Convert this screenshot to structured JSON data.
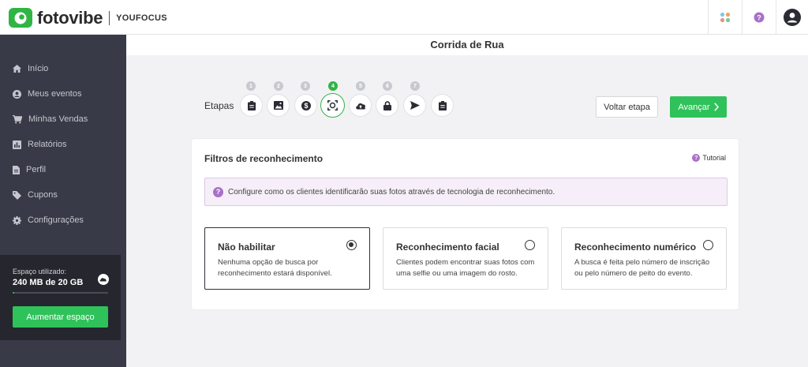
{
  "header": {
    "brand": "fotovibe",
    "sub_brand": "YOUFOCUS",
    "icons": [
      "apps-grid-icon",
      "help-icon",
      "user-avatar-icon"
    ]
  },
  "sidebar": {
    "items": [
      {
        "label": "Início",
        "icon": "home-icon"
      },
      {
        "label": "Meus eventos",
        "icon": "user-circle-icon"
      },
      {
        "label": "Minhas Vendas",
        "icon": "cart-icon"
      },
      {
        "label": "Relatórios",
        "icon": "chart-icon"
      },
      {
        "label": "Perfil",
        "icon": "profile-doc-icon"
      },
      {
        "label": "Cupons",
        "icon": "tag-icon"
      },
      {
        "label": "Configurações",
        "icon": "gear-icon"
      }
    ],
    "storage": {
      "label": "Espaço utilizado:",
      "value": "240 MB de 20 GB",
      "used_fraction": 0.012,
      "button": "Aumentar espaço"
    }
  },
  "page": {
    "title": "Corrida de Rua",
    "steps_label": "Etapas",
    "steps": [
      {
        "num": "1",
        "icon": "clipboard-icon",
        "active": false
      },
      {
        "num": "2",
        "icon": "image-icon",
        "active": false
      },
      {
        "num": "3",
        "icon": "dollar-icon",
        "active": false
      },
      {
        "num": "4",
        "icon": "face-scan-icon",
        "active": true
      },
      {
        "num": "5",
        "icon": "cloud-upload-icon",
        "active": false
      },
      {
        "num": "6",
        "icon": "lock-icon",
        "active": false
      },
      {
        "num": "7",
        "icon": "send-icon",
        "active": false
      },
      {
        "num": "",
        "icon": "clipboard-check-icon",
        "active": false
      }
    ],
    "back_button": "Voltar etapa",
    "next_button": "Avançar"
  },
  "card": {
    "title": "Filtros de reconhecimento",
    "tutorial": "Tutorial",
    "info": "Configure como os clientes identificarão suas fotos através de tecnologia de reconhecimento.",
    "options": [
      {
        "title": "Não habilitar",
        "desc": "Nenhuma opção de busca por reconhecimento estará disponível.",
        "selected": true
      },
      {
        "title": "Reconhecimento facial",
        "desc": "Clientes podem encontrar suas fotos com uma selfie ou uma imagem do rosto.",
        "selected": false
      },
      {
        "title": "Reconhecimento numérico",
        "desc": "A busca é feita pelo número de inscrição ou pelo número de peito do evento.",
        "selected": false
      }
    ]
  },
  "colors": {
    "brand_green": "#2fb544",
    "button_green": "#2fc25a",
    "sidebar_bg": "#383a47",
    "info_purple": "#a771c9"
  }
}
